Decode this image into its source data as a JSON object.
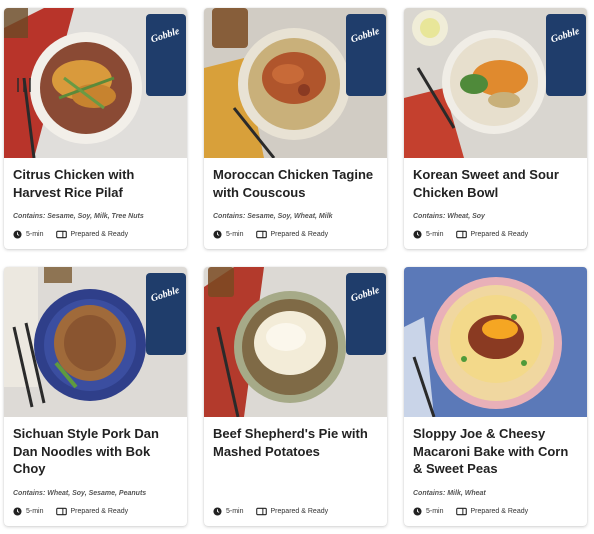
{
  "brand": "Gobble",
  "meals": [
    {
      "title": "Citrus Chicken with Harvest Rice Pilaf",
      "contains": "Contains: Sesame, Soy, Milk, Tree Nuts",
      "time": "5-min",
      "prep": "Prepared & Ready"
    },
    {
      "title": "Moroccan Chicken Tagine with Couscous",
      "contains": "Contains: Sesame, Soy, Wheat, Milk",
      "time": "5-min",
      "prep": "Prepared & Ready"
    },
    {
      "title": "Korean Sweet and Sour Chicken Bowl",
      "contains": "Contains: Wheat, Soy",
      "time": "5-min",
      "prep": "Prepared & Ready"
    },
    {
      "title": "Sichuan Style Pork Dan Dan Noodles with Bok Choy",
      "contains": "Contains: Wheat, Soy, Sesame, Peanuts",
      "time": "5-min",
      "prep": "Prepared & Ready"
    },
    {
      "title": "Beef Shepherd's Pie with Mashed Potatoes",
      "contains": "",
      "time": "5-min",
      "prep": "Prepared & Ready"
    },
    {
      "title": "Sloppy Joe & Cheesy Macaroni Bake with Corn & Sweet Peas",
      "contains": "Contains: Milk, Wheat",
      "time": "5-min",
      "prep": "Prepared & Ready"
    }
  ],
  "icons": {
    "time": "clock-icon",
    "prep": "meal-tray-icon"
  },
  "colors": {
    "card_bg": "#ffffff",
    "brand_box": "#1f3d6b",
    "text": "#222222"
  }
}
